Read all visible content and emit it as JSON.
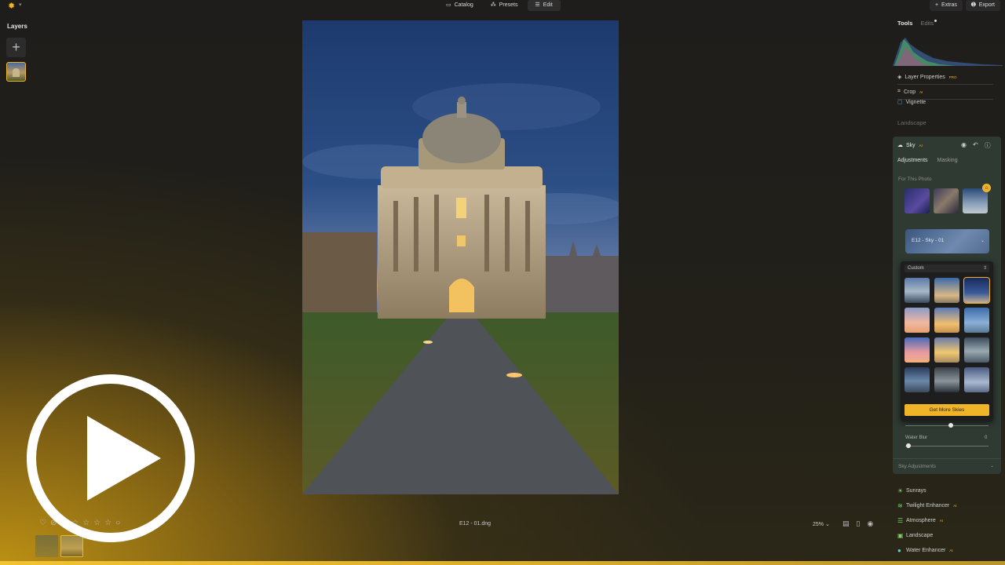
{
  "topbar": {
    "tabs": [
      {
        "label": "Catalog",
        "icon": "folder-icon"
      },
      {
        "label": "Presets",
        "icon": "wand-icon"
      },
      {
        "label": "Edit",
        "icon": "sliders-icon"
      }
    ],
    "extras_label": "Extras",
    "export_label": "Export"
  },
  "layers": {
    "title": "Layers",
    "add_symbol": "+"
  },
  "footer": {
    "filename": "E12 - 01.dng",
    "zoom": "25%"
  },
  "right_panel": {
    "tabs": [
      {
        "label": "Tools"
      },
      {
        "label": "Edits"
      }
    ],
    "rows": [
      {
        "label": "Layer Properties",
        "badge": "PRO"
      },
      {
        "label": "Crop",
        "badge": "AI"
      },
      {
        "label": "Vignette",
        "badge": ""
      }
    ],
    "section_title": "Landscape",
    "sky": {
      "title": "Sky",
      "badge": "AI",
      "subtabs": [
        "Adjustments",
        "Masking"
      ],
      "for_photo_label": "For This Photo",
      "selected_sky": "E12 - Sky - 01",
      "popup_category": "Custom",
      "get_more_label": "Get More Skies",
      "water_blur_label": "Water Blur",
      "water_blur_value": "0",
      "slider_level": 0.55,
      "sky_adjustments_label": "Sky Adjustments"
    },
    "tools": [
      {
        "label": "Sunrays",
        "badge": "",
        "icon": "sun-icon"
      },
      {
        "label": "Twilight Enhancer",
        "badge": "AI",
        "icon": "twilight-icon"
      },
      {
        "label": "Atmosphere",
        "badge": "AI",
        "icon": "atmosphere-icon"
      },
      {
        "label": "Landscape",
        "badge": "",
        "icon": "landscape-icon"
      },
      {
        "label": "Water Enhancer",
        "badge": "AI",
        "icon": "water-drop-icon"
      }
    ]
  },
  "colors": {
    "accent": "#f0b429",
    "panel": "#2f3a33"
  }
}
